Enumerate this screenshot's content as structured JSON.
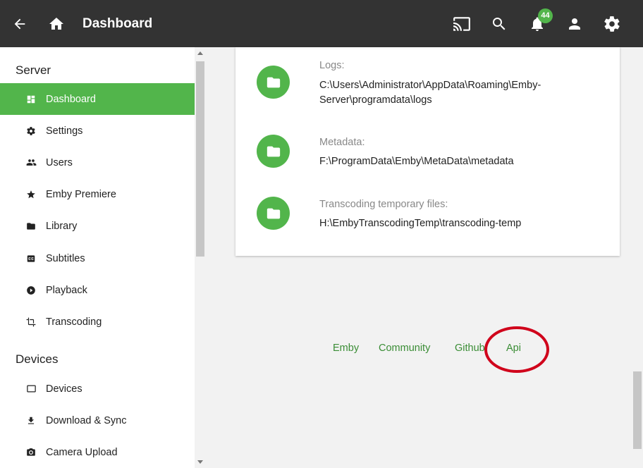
{
  "header": {
    "title": "Dashboard",
    "notification_count": "44",
    "icons": [
      "back-arrow-icon",
      "home-icon",
      "cast-icon",
      "search-icon",
      "bell-icon",
      "user-icon",
      "gear-icon"
    ],
    "background": "#333333"
  },
  "sidebar": {
    "server_section": "Server",
    "server_items": [
      {
        "label": "Dashboard",
        "icon": "dashboard-icon",
        "active": true
      },
      {
        "label": "Settings",
        "icon": "gear-icon"
      },
      {
        "label": "Users",
        "icon": "users-icon"
      },
      {
        "label": "Emby Premiere",
        "icon": "star-icon"
      },
      {
        "label": "Library",
        "icon": "folder-icon"
      },
      {
        "label": "Subtitles",
        "icon": "subtitles-icon"
      },
      {
        "label": "Playback",
        "icon": "play-circle-icon"
      },
      {
        "label": "Transcoding",
        "icon": "crop-icon"
      }
    ],
    "devices_section": "Devices",
    "devices_items": [
      {
        "label": "Devices",
        "icon": "device-icon"
      },
      {
        "label": "Download & Sync",
        "icon": "download-icon"
      },
      {
        "label": "Camera Upload",
        "icon": "camera-icon"
      }
    ]
  },
  "paths": [
    {
      "label": "Logs:",
      "value": "C:\\Users\\Administrator\\AppData\\Roaming\\Emby-Server\\programdata\\logs"
    },
    {
      "label": "Metadata:",
      "value": "F:\\ProgramData\\Emby\\MetaData\\metadata"
    },
    {
      "label": "Transcoding temporary files:",
      "value": "H:\\EmbyTranscodingTemp\\transcoding-temp"
    }
  ],
  "footer": {
    "links": [
      "Emby",
      "Community",
      "Github",
      "Api"
    ]
  },
  "colors": {
    "accent": "#52b54b",
    "link": "#3a8d35",
    "annotation": "#d0021b"
  }
}
